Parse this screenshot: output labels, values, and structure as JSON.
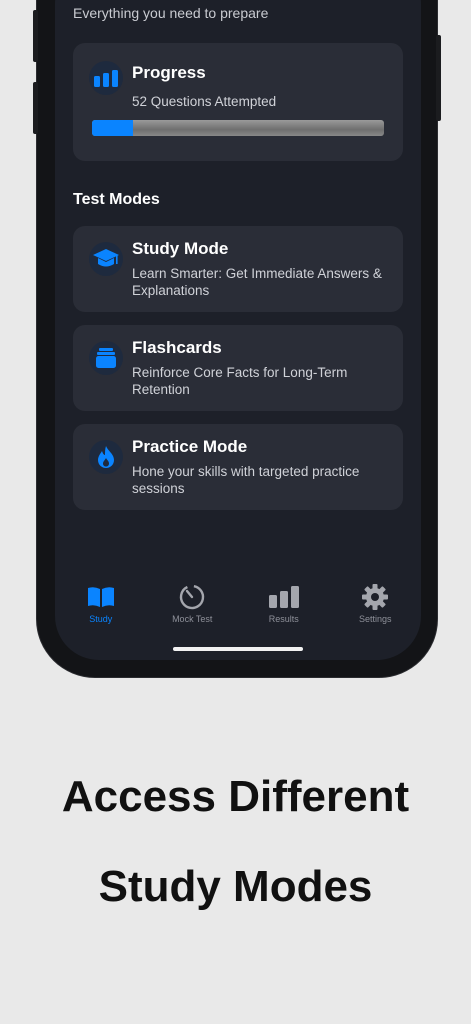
{
  "header": {
    "subtitle": "Everything you need to prepare"
  },
  "progress": {
    "title": "Progress",
    "detail": "52 Questions Attempted",
    "fraction": 0.14
  },
  "modes": {
    "section_title": "Test Modes",
    "items": [
      {
        "title": "Study Mode",
        "desc": "Learn Smarter: Get Immediate Answers & Explanations",
        "icon": "graduation-cap-icon"
      },
      {
        "title": "Flashcards",
        "desc": "Reinforce Core Facts for Long-Term Retention",
        "icon": "cards-stack-icon"
      },
      {
        "title": "Practice Mode",
        "desc": "Hone your skills with targeted practice sessions",
        "icon": "flame-icon"
      }
    ]
  },
  "tabs": [
    {
      "label": "Study",
      "icon": "book-icon",
      "active": true
    },
    {
      "label": "Mock Test",
      "icon": "timer-icon",
      "active": false
    },
    {
      "label": "Results",
      "icon": "bar-chart-icon",
      "active": false
    },
    {
      "label": "Settings",
      "icon": "gear-icon",
      "active": false
    }
  ],
  "caption": {
    "line1": "Access Different",
    "line2": "Study Modes"
  },
  "colors": {
    "accent": "#0a84ff",
    "screen_bg": "#1d2029",
    "card_bg": "#2a2d37",
    "page_bg": "#e9e9e9"
  }
}
